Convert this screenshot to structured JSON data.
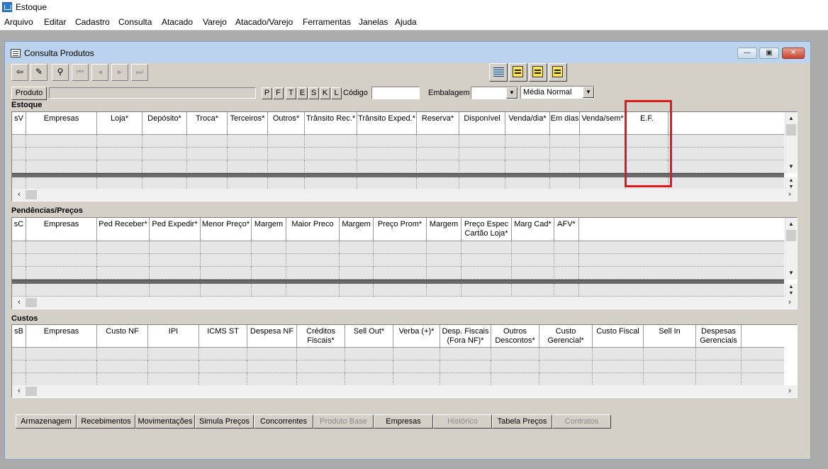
{
  "app": {
    "title": "Estoque"
  },
  "menu": [
    "Arquivo",
    "Editar",
    "Cadastro",
    "Consulta",
    "Atacado",
    "Varejo",
    "Atacado/Varejo",
    "Ferramentas",
    "Janelas",
    "Ajuda"
  ],
  "window": {
    "title": "Consulta Produtos",
    "controls": [
      "minimize",
      "restore",
      "close"
    ]
  },
  "toolbar": {
    "left": [
      {
        "icon": "exit-door-icon",
        "glyph": "⇦",
        "enabled": true
      },
      {
        "icon": "eraser-icon",
        "glyph": "✎",
        "enabled": true
      },
      {
        "icon": "binoculars-icon",
        "glyph": "⚲",
        "enabled": true
      },
      {
        "icon": "first-record-icon",
        "glyph": "⏮",
        "enabled": false
      },
      {
        "icon": "previous-record-icon",
        "glyph": "◂",
        "enabled": false
      },
      {
        "icon": "next-record-icon",
        "glyph": "▸",
        "enabled": false
      },
      {
        "icon": "last-record-icon",
        "glyph": "⏭",
        "enabled": false
      }
    ],
    "right": [
      "grid-view-icon",
      "yellow-list-icon-1",
      "yellow-list-icon-2",
      "yellow-list-icon-3"
    ]
  },
  "filter": {
    "produto_button": "Produto",
    "produto_value": "",
    "letters": [
      "P",
      "F",
      "T",
      "E",
      "S",
      "K",
      "L"
    ],
    "codigo_label": "Código",
    "codigo_value": "",
    "embalagem_label": "Embalagem",
    "embalagem_value": "",
    "media_value": "Média Normal"
  },
  "estoque": {
    "title": "Estoque",
    "columns": [
      "sV",
      "Empresas",
      "Loja*",
      "Depósito*",
      "Troca*",
      "Terceiros*",
      "Outros*",
      "Trânsito Rec.*",
      "Trânsito Exped.*",
      "Reserva*",
      "Disponível",
      "Venda/dia*",
      "Em dias",
      "Venda/sem*",
      "E.F."
    ]
  },
  "pendencias": {
    "title": "Pendências/Preços",
    "columns": [
      "sC",
      "Empresas",
      "Ped Receber*",
      "Ped Expedir*",
      "Menor Preço*",
      "Margem",
      "Maior Preco",
      "Margem",
      "Preço Prom*",
      "Margem",
      "Preço Espec Cartão Loja*",
      "Marg Cad*",
      "AFV*"
    ]
  },
  "custos": {
    "title": "Custos",
    "columns": [
      "sB",
      "Empresas",
      "Custo NF",
      "IPI",
      "ICMS ST",
      "Despesa NF",
      "Créditos Fiscais*",
      "Sell Out*",
      "Verba (+)*",
      "Desp. Fiscais (Fora NF)*",
      "Outros Descontos*",
      "Custo Gerencial*",
      "Custo Fiscal",
      "Sell In",
      "Despesas Gerenciais"
    ]
  },
  "tabs": [
    {
      "label": "Armazenagem",
      "enabled": true
    },
    {
      "label": "Recebimentos",
      "enabled": true
    },
    {
      "label": "Movimentações",
      "enabled": true
    },
    {
      "label": "Simula Preços",
      "enabled": true
    },
    {
      "label": "Concorrentes",
      "enabled": true
    },
    {
      "label": "Produto Base",
      "enabled": false
    },
    {
      "label": "Empresas",
      "enabled": true
    },
    {
      "label": "Histórico",
      "enabled": false
    },
    {
      "label": "Tabela Preços",
      "enabled": true
    },
    {
      "label": "Contratos",
      "enabled": false
    }
  ],
  "colors": {
    "highlight": "#e01a1a",
    "window_title": "#bcd3ee",
    "face": "#d4d0c8"
  }
}
